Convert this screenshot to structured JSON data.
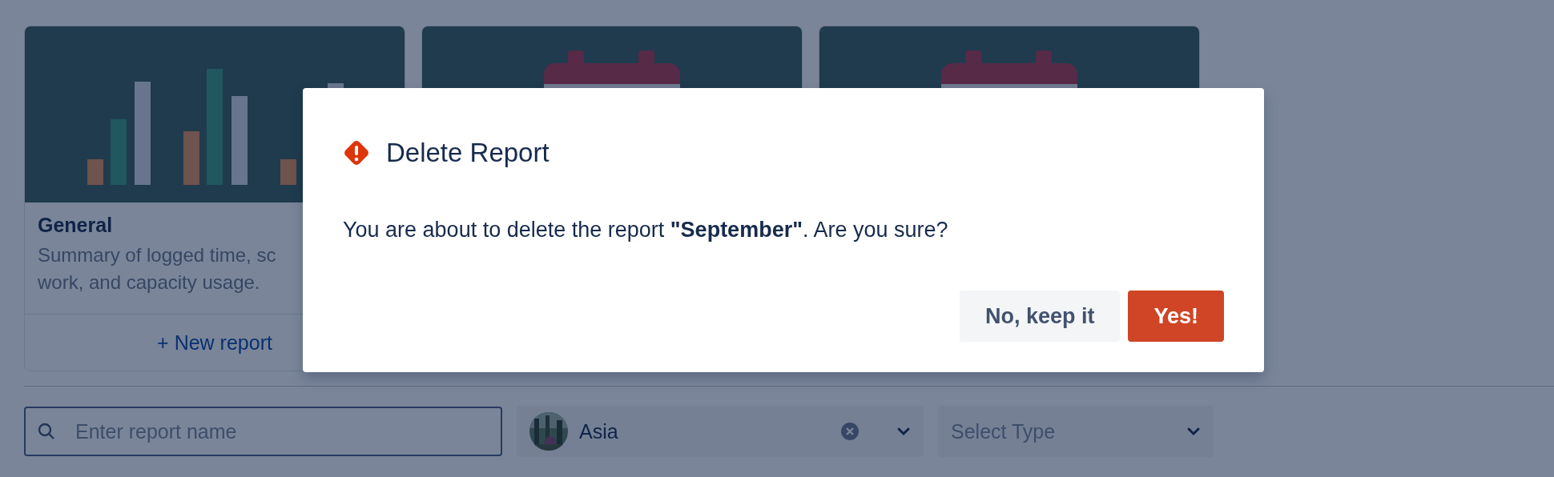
{
  "cards": [
    {
      "kind": "chart",
      "title": "General",
      "description": "Summary of logged time, sc",
      "description_2": "work, and capacity usage.",
      "action": "+ New report"
    },
    {
      "kind": "calendar"
    },
    {
      "kind": "calendar"
    }
  ],
  "filters": {
    "search": {
      "placeholder": "Enter report name"
    },
    "region": {
      "value": "Asia"
    },
    "type": {
      "placeholder": "Select Type"
    }
  },
  "dialog": {
    "title": "Delete Report",
    "message": "You are about to delete the report **\"September\"**. Are you sure?",
    "buttons": [
      {
        "kind": "secondary",
        "label": "No, keep it"
      },
      {
        "kind": "danger",
        "label": "Yes!"
      }
    ]
  }
}
